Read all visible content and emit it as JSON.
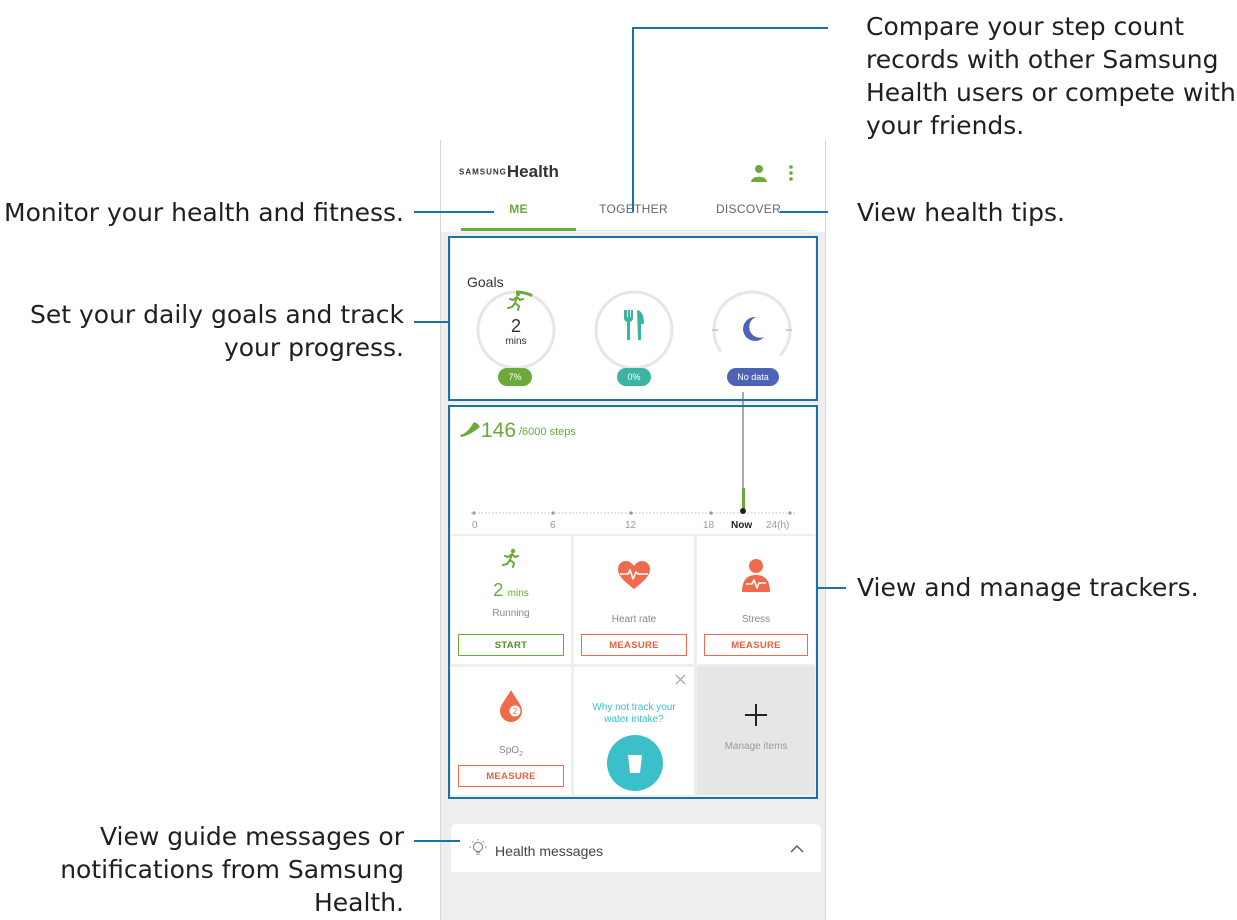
{
  "app": {
    "brand_small": "SAMSUNG",
    "brand_large": "Health"
  },
  "tabs": [
    {
      "label": "ME",
      "active": true
    },
    {
      "label": "TOGETHER",
      "active": false
    },
    {
      "label": "DISCOVER",
      "active": false
    }
  ],
  "goals": {
    "title": "Goals",
    "activity": {
      "icon": "running-icon",
      "value": "2",
      "unit": "mins",
      "badge": "7%",
      "progress": 0.07,
      "color": "#6aa93a"
    },
    "food": {
      "icon": "fork-knife-icon",
      "badge": "0%",
      "progress": 0,
      "color": "#3bb4a4"
    },
    "sleep": {
      "icon": "moon-icon",
      "badge": "No data",
      "color": "#4c63b6"
    }
  },
  "steps": {
    "value": "146",
    "goal": "/6000",
    "unit": "steps",
    "axis_labels": [
      "0",
      "6",
      "12",
      "18",
      "Now",
      "24(h)"
    ]
  },
  "trackers": [
    {
      "name": "Running",
      "value": "2",
      "unit": "mins",
      "button": "START",
      "icon": "running-icon"
    },
    {
      "name": "Heart rate",
      "button": "MEASURE",
      "icon": "heart-rate-icon"
    },
    {
      "name": "Stress",
      "button": "MEASURE",
      "icon": "stress-icon"
    },
    {
      "name": "SpO",
      "sub": "2",
      "button": "MEASURE",
      "icon": "spo2-drop-icon"
    },
    {
      "name": "water-suggestion",
      "text_line1": "Why not track your",
      "text_line2": "water intake?",
      "icon": "water-cup-icon"
    },
    {
      "name": "Manage items",
      "icon": "plus-icon"
    }
  ],
  "health_messages": {
    "label": "Health messages",
    "icon": "lightbulb-icon"
  },
  "callouts": {
    "together": [
      "Compare your step count",
      "records with other Samsung",
      "Health users or compete with",
      "your friends."
    ],
    "me": "Monitor your health and fitness.",
    "discover": "View health tips.",
    "goals": [
      "Set your daily goals and track",
      "your progress."
    ],
    "trackers": "View and manage trackers.",
    "messages": [
      "View guide messages or",
      "notifications from Samsung",
      "Health."
    ]
  },
  "colors": {
    "accent_green": "#6aa93a",
    "orange": "#ef6b4b",
    "teal": "#3bbfc9",
    "indigo": "#4c63b6",
    "callout_line": "#1a73a8"
  }
}
